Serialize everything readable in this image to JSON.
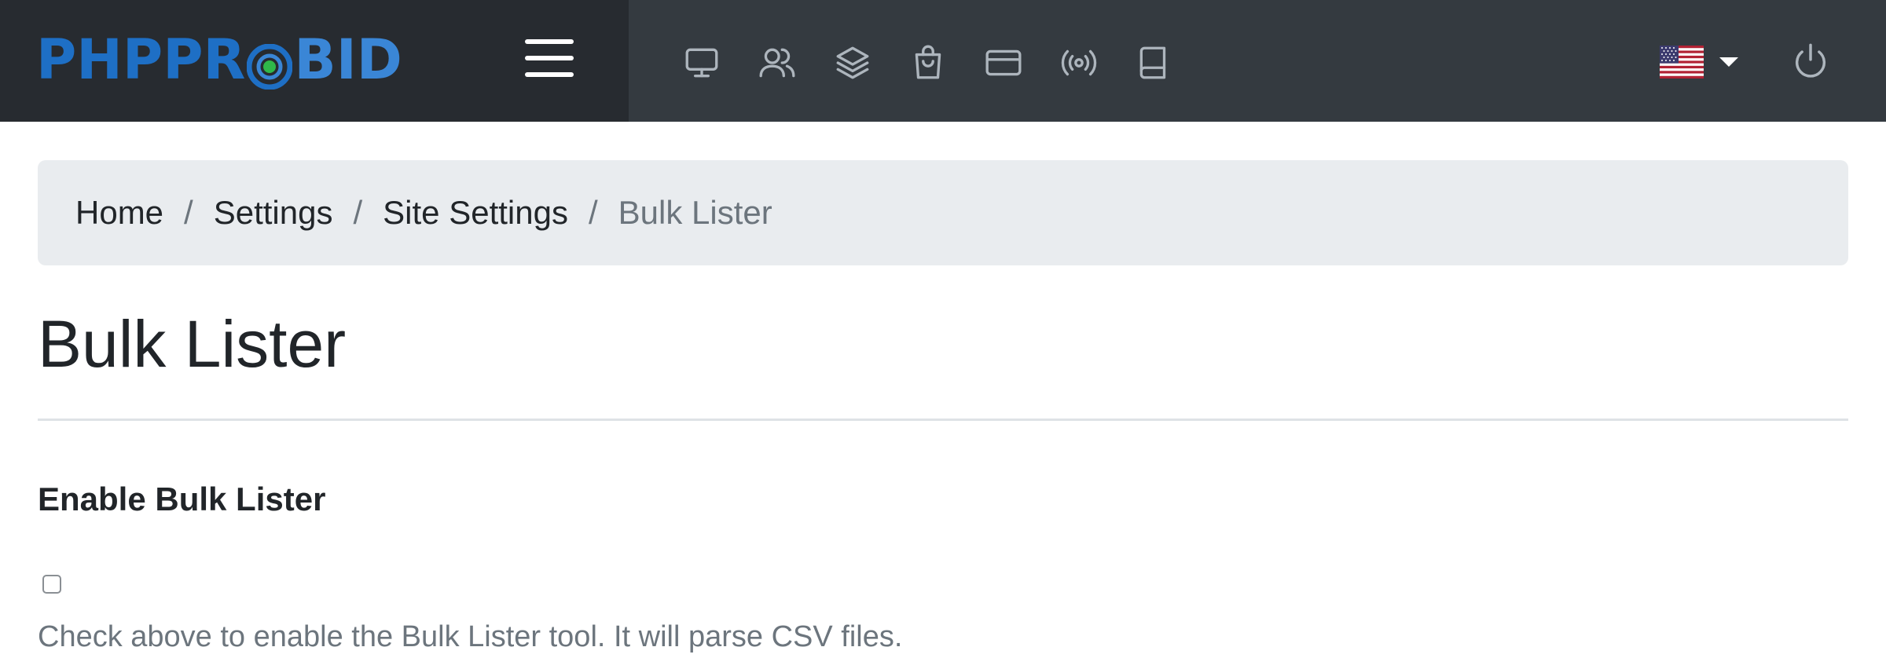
{
  "brand": {
    "logo_part1": "PHPPR",
    "logo_part2": "BID",
    "colors": {
      "primary": "#1e6fc5",
      "secondary": "#3a86d6",
      "accent": "#2fb84a"
    }
  },
  "topbar": {
    "nav_icons": [
      "monitor-icon",
      "users-icon",
      "layers-icon",
      "shopping-bag-icon",
      "credit-card-icon",
      "broadcast-icon",
      "book-icon"
    ],
    "language": "us-flag",
    "power_icon": "power-icon"
  },
  "breadcrumb": {
    "items": [
      "Home",
      "Settings",
      "Site Settings"
    ],
    "separator": "/",
    "active": "Bulk Lister"
  },
  "page": {
    "title": "Bulk Lister",
    "field_label": "Enable Bulk Lister",
    "checkbox_checked": false,
    "help_text": "Check above to enable the Bulk Lister tool. It will parse CSV files."
  }
}
